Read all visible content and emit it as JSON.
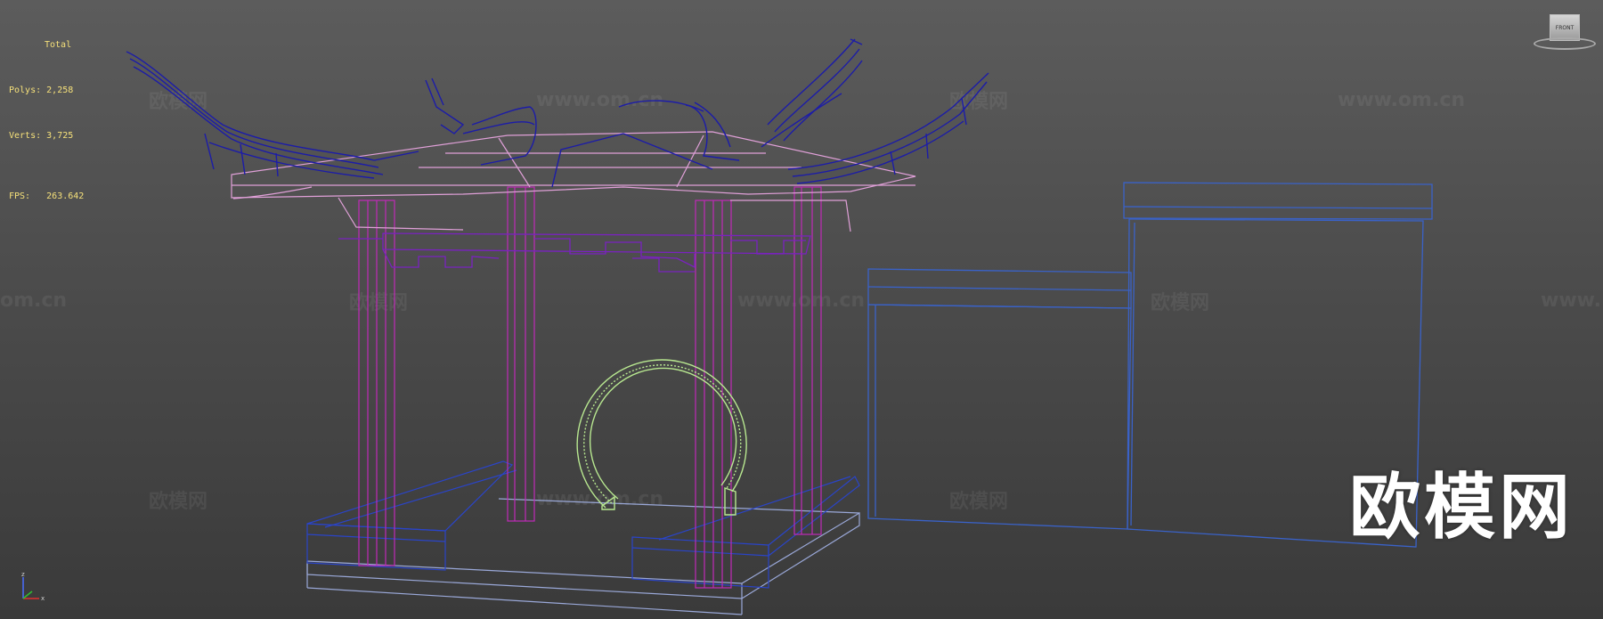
{
  "stats": {
    "title": "Total",
    "polys_label": "Polys:",
    "polys_value": "2,258",
    "verts_label": "Verts:",
    "verts_value": "3,725",
    "fps_label": "FPS:",
    "fps_value": "263.642"
  },
  "viewcube": {
    "face_label": "FRONT"
  },
  "watermarks": {
    "cn": "欧模网",
    "url": "www.om.cn",
    "url_partial_left": "om.cn",
    "url_partial_right": "www.",
    "big": "欧模网"
  },
  "axis": {
    "z_label": "z",
    "x_label": "x"
  },
  "colors": {
    "roof": "#1c1ca8",
    "trim": "#e0a0d8",
    "columns": "#c02ab8",
    "lattice": "#7a22c0",
    "moon_gate": "#b8e890",
    "wall": "#3a62c8",
    "platform": "#9aa8d8",
    "bench": "#2a44c8",
    "stats_text": "#f5e07a"
  }
}
